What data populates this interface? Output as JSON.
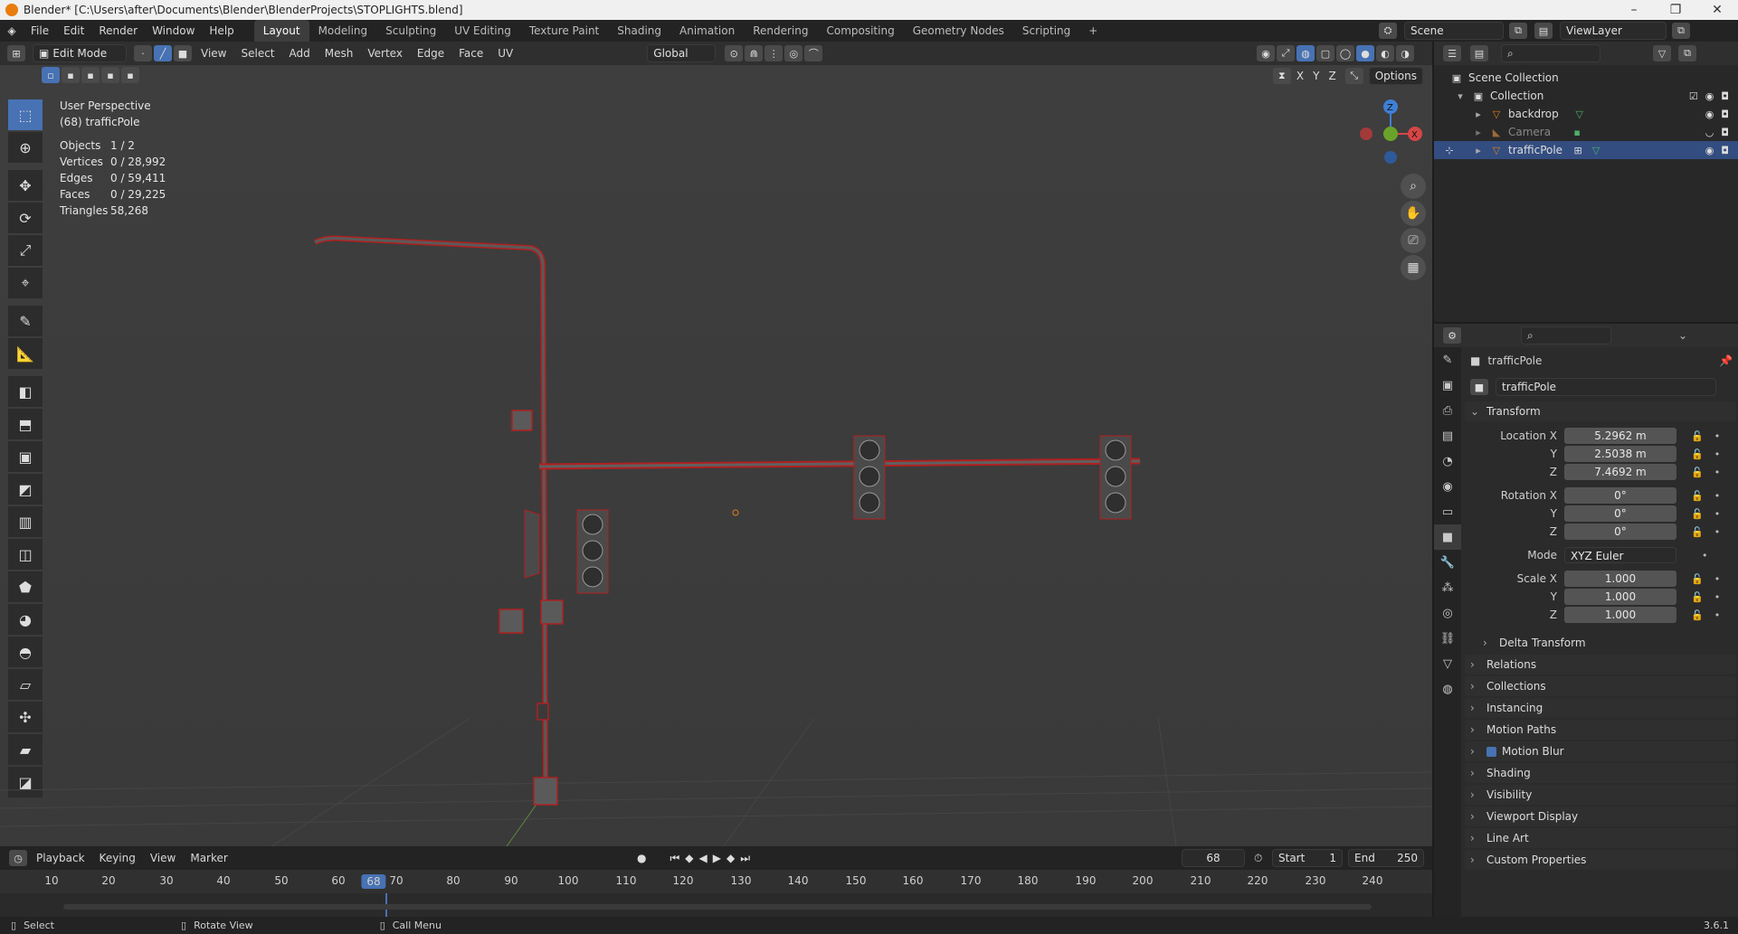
{
  "window": {
    "title": "Blender* [C:\\Users\\after\\Documents\\Blender\\BlenderProjects\\STOPLIGHTS.blend]",
    "controls": [
      "–",
      "❐",
      "✕"
    ]
  },
  "menu": [
    "File",
    "Edit",
    "Render",
    "Window",
    "Help"
  ],
  "workspaces": {
    "tabs": [
      "Layout",
      "Modeling",
      "Sculpting",
      "UV Editing",
      "Texture Paint",
      "Shading",
      "Animation",
      "Rendering",
      "Compositing",
      "Geometry Nodes",
      "Scripting"
    ],
    "active": "Layout",
    "add": "+"
  },
  "scene": {
    "name": "Scene",
    "view_layer": "ViewLayer"
  },
  "viewport_header": {
    "mode": "Edit Mode",
    "menus": [
      "View",
      "Select",
      "Add",
      "Mesh",
      "Vertex",
      "Edge",
      "Face",
      "UV"
    ],
    "orientation": "Global",
    "axes": [
      "X",
      "Y",
      "Z"
    ],
    "options": "Options"
  },
  "viewport": {
    "perspective": "User Perspective",
    "object_label": "(68) trafficPole",
    "stats": [
      {
        "k": "Objects",
        "v": "1 / 2"
      },
      {
        "k": "Vertices",
        "v": "0 / 28,992"
      },
      {
        "k": "Edges",
        "v": "0 / 59,411"
      },
      {
        "k": "Faces",
        "v": "0 / 29,225"
      },
      {
        "k": "Triangles",
        "v": "58,268"
      }
    ],
    "gizmo": {
      "z": "Z",
      "x": "X"
    }
  },
  "timeline": {
    "menus": [
      "Playback",
      "Keying",
      "View",
      "Marker"
    ],
    "current_frame": "68",
    "start_label": "Start",
    "start": "1",
    "end_label": "End",
    "end": "250",
    "ruler": [
      "10",
      "20",
      "30",
      "40",
      "50",
      "60",
      "70",
      "80",
      "90",
      "100",
      "110",
      "120",
      "130",
      "140",
      "150",
      "160",
      "170",
      "180",
      "190",
      "200",
      "210",
      "220",
      "230",
      "240"
    ]
  },
  "outliner": {
    "root": "Scene Collection",
    "collection": "Collection",
    "items": [
      "backdrop",
      "Camera",
      "trafficPole"
    ],
    "selected": "trafficPole"
  },
  "properties": {
    "object_name": "trafficPole",
    "datablock": "trafficPole",
    "transform_title": "Transform",
    "location_label": "Location X",
    "location": [
      "5.2962 m",
      "2.5038 m",
      "7.4692 m"
    ],
    "rotation_label": "Rotation X",
    "rotation": [
      "0°",
      "0°",
      "0°"
    ],
    "mode_label": "Mode",
    "mode": "XYZ Euler",
    "scale_label": "Scale X",
    "scale": [
      "1.000",
      "1.000",
      "1.000"
    ],
    "axis_y": "Y",
    "axis_z": "Z",
    "panels": [
      "Delta Transform",
      "Relations",
      "Collections",
      "Instancing",
      "Motion Paths",
      "Motion Blur",
      "Shading",
      "Visibility",
      "Viewport Display",
      "Line Art",
      "Custom Properties"
    ]
  },
  "statusbar": {
    "select": "Select",
    "rotate": "Rotate View",
    "call_menu": "Call Menu",
    "version": "3.6.1"
  },
  "colors": {
    "accent": "#4772b3",
    "wire_selected": "#e03030",
    "gizmo_x": "#d64545",
    "gizmo_y": "#6aa32a",
    "gizmo_z": "#3f7fd6"
  }
}
